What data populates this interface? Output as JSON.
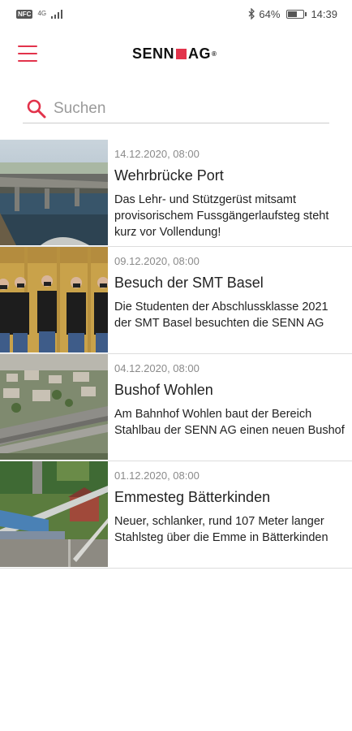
{
  "status_bar": {
    "sim_label": "NFC",
    "network_label": "4G",
    "battery_percent": "64%",
    "battery_level": 0.64,
    "time": "14:39"
  },
  "app_bar": {
    "menu_icon": "hamburger-menu-icon",
    "logo_left": "SENN",
    "logo_right": "AG",
    "logo_reg": "®"
  },
  "search": {
    "icon": "search-icon",
    "placeholder": "Suchen",
    "value": ""
  },
  "colors": {
    "accent": "#e2334b"
  },
  "news": [
    {
      "date": "14.12.2020, 08:00",
      "title": "Wehrbrücke Port",
      "description": "Das Lehr- und Stützgerüst mitsamt provisorischem Fussgängerlaufsteg steht kurz vor Vollendung!"
    },
    {
      "date": "09.12.2020, 08:00",
      "title": "Besuch der SMT Basel",
      "description": "Die Studenten der Abschlussklasse 2021 der SMT Basel besuchten die SENN AG"
    },
    {
      "date": "04.12.2020, 08:00",
      "title": "Bushof Wohlen",
      "description": "Am Bahnhof Wohlen baut der Bereich Stahlbau der SENN AG einen neuen Bushof"
    },
    {
      "date": "01.12.2020, 08:00",
      "title": "Emmesteg Bätterkinden",
      "description": "Neuer, schlanker, rund 107 Meter langer Stahlsteg über die Emme in Bätterkinden"
    }
  ]
}
